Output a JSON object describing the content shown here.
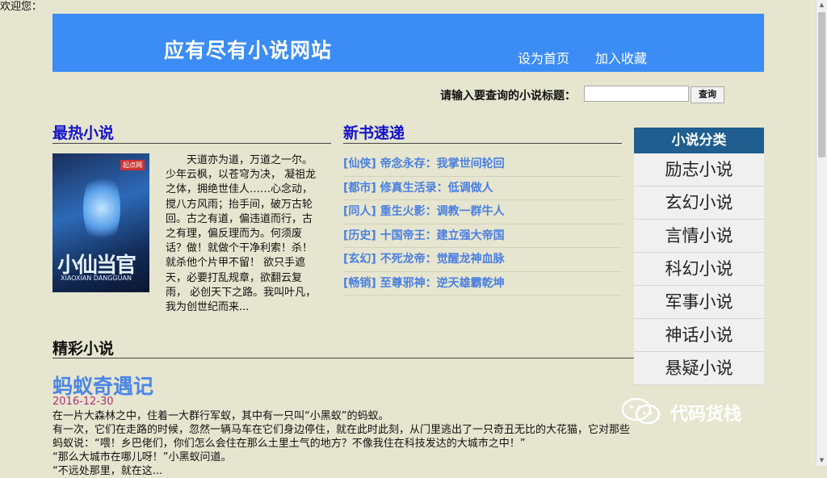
{
  "welcome": "欢迎您：",
  "header": {
    "title": "应有尽有小说网站",
    "links": [
      "设为首页",
      "加入收藏"
    ]
  },
  "search": {
    "label": "请输入要查询的小说标题：",
    "value": "",
    "button": "查询"
  },
  "hot": {
    "title": "最热小说",
    "cover": {
      "title": "小仙当官",
      "subtitle": "XIAOXIAN DANGGUAN",
      "tag": "起点网"
    },
    "description": "天道亦为道，万道之一尔。少年云枫，以苍穹为决， 凝祖龙之体，拥绝世佳人……心念动，搅八方风雨；抬手间，破万古轮回。古之有道，偏违道而行，古之有理，偏反理而为。何须废话？做！就做个干净利索！杀！就杀他个片甲不留！ 欲只手遮天，必要打乱规章，欲翻云复雨， 必创天下之路。我叫叶凡，我为创世纪而来..."
  },
  "new_books": {
    "title": "新书速递",
    "items": [
      "[仙侠] 帝念永存：我掌世间轮回",
      "[都市] 修真生活录：低调做人",
      "[同人] 重生火影：调教一群牛人",
      "[历史] 十国帝王：建立强大帝国",
      "[玄幻] 不死龙帝：觉醒龙神血脉",
      "[畅销] 至尊邪神：逆天雄霸乾坤"
    ]
  },
  "categories": {
    "title": "小说分类",
    "items": [
      "励志小说",
      "玄幻小说",
      "言情小说",
      "科幻小说",
      "军事小说",
      "神话小说",
      "悬疑小说"
    ]
  },
  "featured": {
    "section_title": "精彩小说",
    "story": {
      "title": "蚂蚁奇遇记",
      "date": "2016-12-30",
      "paragraphs": [
        "在一片大森林之中，住着一大群行军蚁，其中有一只叫“小黑蚁”的蚂蚁。",
        "有一次，它们在走路的时候，忽然一辆马车在它们身边停住，就在此时此刻，从门里逃出了一只奇丑无比的大花猫，它对那些蚂蚁说：“喂！乡巴佬们，你们怎么会住在那么土里土气的地方？不像我住在科技发达的大城市之中！”",
        "“那么大城市在哪儿呀！”小黑蚁问道。",
        "“不远处那里，就在这..."
      ]
    }
  },
  "watermark": "代码货栈",
  "colors": {
    "background": "#e6e5cf",
    "header": "#3b8cf5",
    "section_title_blue": "#1212cc",
    "news_link": "#4a7fe0",
    "category_header": "#1f5e8f",
    "story_title": "#4a86e8",
    "date": "#b0307a"
  }
}
